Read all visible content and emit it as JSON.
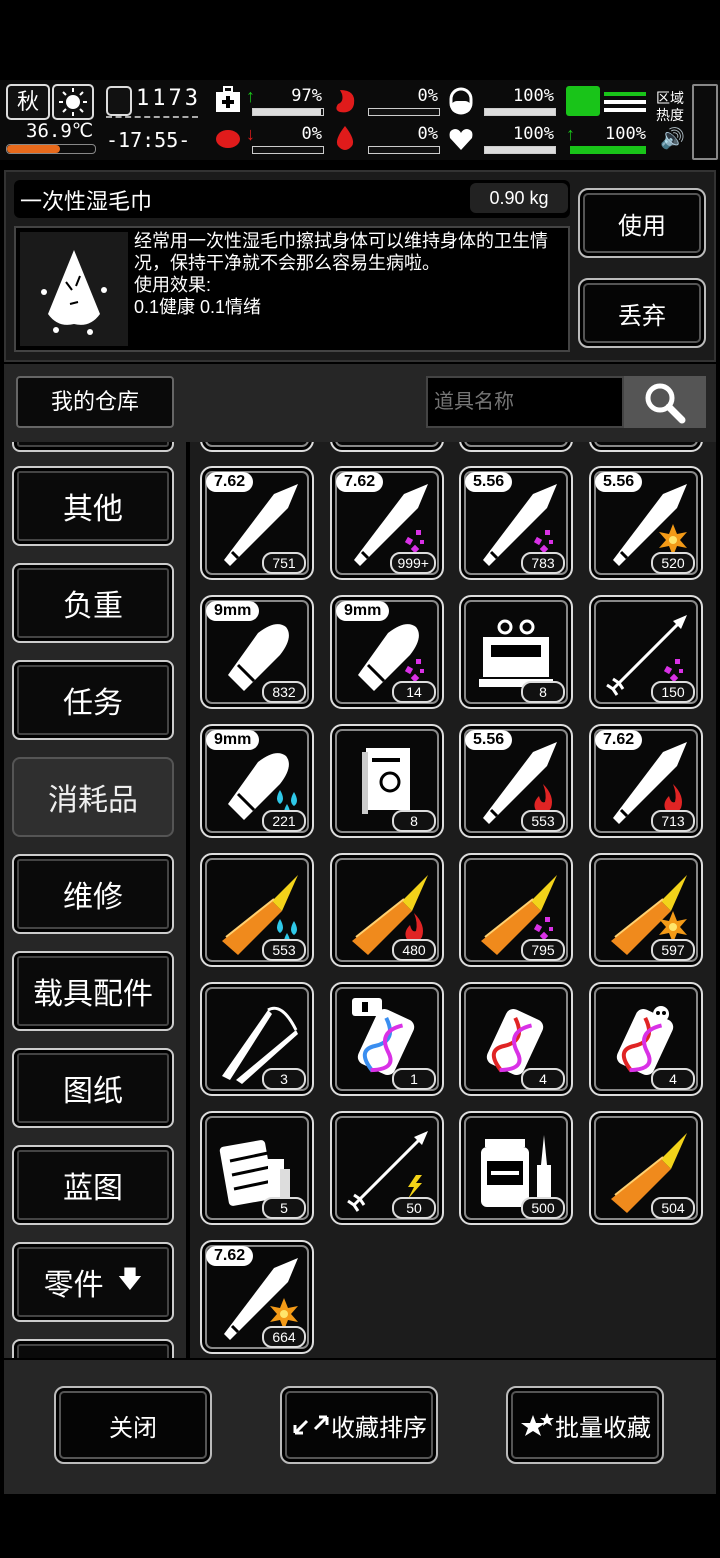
{
  "status": {
    "season": "秋",
    "temperature": "36.9℃",
    "day_counter": "1173",
    "clock": "-17:55-",
    "health_pct": "97%",
    "hunger_pct": "0%",
    "stomach_pct": "100%",
    "stamina_pct": "100%",
    "infection_pct": "0%",
    "blood_pct": "0%",
    "mood_pct": "100%",
    "carry_pct": "100%",
    "region_heat_label": "区域热度",
    "colors": {
      "green": "#19c419",
      "red": "#e01b1b",
      "bg": "#0b0b0b"
    }
  },
  "detail": {
    "name": "一次性湿毛巾",
    "weight": "0.90 kg",
    "description": "经常用一次性湿毛巾擦拭身体可以维持身体的卫生情况，保持干净就不会那么容易生病啦。",
    "effect_label": "使用效果:",
    "effect_value": "0.1健康 0.1情绪",
    "use_label": "使用",
    "discard_label": "丢弃"
  },
  "warehouse": {
    "title": "我的仓库",
    "search_placeholder": "道具名称",
    "search_icon": "magnifier-icon"
  },
  "categories": [
    {
      "label": "其他"
    },
    {
      "label": "负重"
    },
    {
      "label": "任务"
    },
    {
      "label": "消耗品",
      "active": true
    },
    {
      "label": "维修"
    },
    {
      "label": "载具配件"
    },
    {
      "label": "图纸"
    },
    {
      "label": "蓝图"
    },
    {
      "label": "零件",
      "icon": "arrow-down-icon"
    }
  ],
  "items": [
    {
      "caliber": "7.62",
      "count": "751",
      "icon": "rifle-bullet-icon"
    },
    {
      "caliber": "7.62",
      "count": "999+",
      "icon": "rifle-bullet-spark-icon"
    },
    {
      "caliber": "5.56",
      "count": "783",
      "icon": "rifle-bullet-spark-icon"
    },
    {
      "caliber": "5.56",
      "count": "520",
      "icon": "rifle-bullet-explosive-icon"
    },
    {
      "caliber": "9mm",
      "count": "832",
      "icon": "pistol-bullet-icon"
    },
    {
      "caliber": "9mm",
      "count": "14",
      "icon": "pistol-bullet-spark-icon"
    },
    {
      "caliber": "",
      "count": "8",
      "icon": "ration-box-icon"
    },
    {
      "caliber": "",
      "count": "150",
      "icon": "arrow-spark-icon"
    },
    {
      "caliber": "9mm",
      "count": "221",
      "icon": "pistol-bullet-water-icon"
    },
    {
      "caliber": "",
      "count": "8",
      "icon": "book-icon"
    },
    {
      "caliber": "5.56",
      "count": "553",
      "icon": "rifle-bullet-fire-icon"
    },
    {
      "caliber": "7.62",
      "count": "713",
      "icon": "rifle-bullet-fire-icon"
    },
    {
      "caliber": "",
      "count": "553",
      "icon": "shell-water-icon"
    },
    {
      "caliber": "",
      "count": "480",
      "icon": "shell-fire-icon"
    },
    {
      "caliber": "",
      "count": "795",
      "icon": "shell-spark-icon"
    },
    {
      "caliber": "",
      "count": "597",
      "icon": "shell-explosive-icon"
    },
    {
      "caliber": "",
      "count": "3",
      "icon": "tweezers-icon"
    },
    {
      "caliber": "",
      "count": "1",
      "icon": "dna-capsule-icon"
    },
    {
      "caliber": "",
      "count": "4",
      "icon": "dna-capsule-broken-icon"
    },
    {
      "caliber": "",
      "count": "4",
      "icon": "dna-capsule-skull-icon"
    },
    {
      "caliber": "",
      "count": "5",
      "icon": "supply-bundle-icon"
    },
    {
      "caliber": "",
      "count": "50",
      "icon": "arrow-electric-icon"
    },
    {
      "caliber": "",
      "count": "500",
      "icon": "medicine-vial-icon"
    },
    {
      "caliber": "",
      "count": "504",
      "icon": "shell-icon"
    },
    {
      "caliber": "7.62",
      "count": "664",
      "icon": "rifle-bullet-explosive-icon"
    }
  ],
  "bottom": {
    "close_label": "关闭",
    "sort_label": "收藏排序",
    "batch_label": "批量收藏"
  }
}
